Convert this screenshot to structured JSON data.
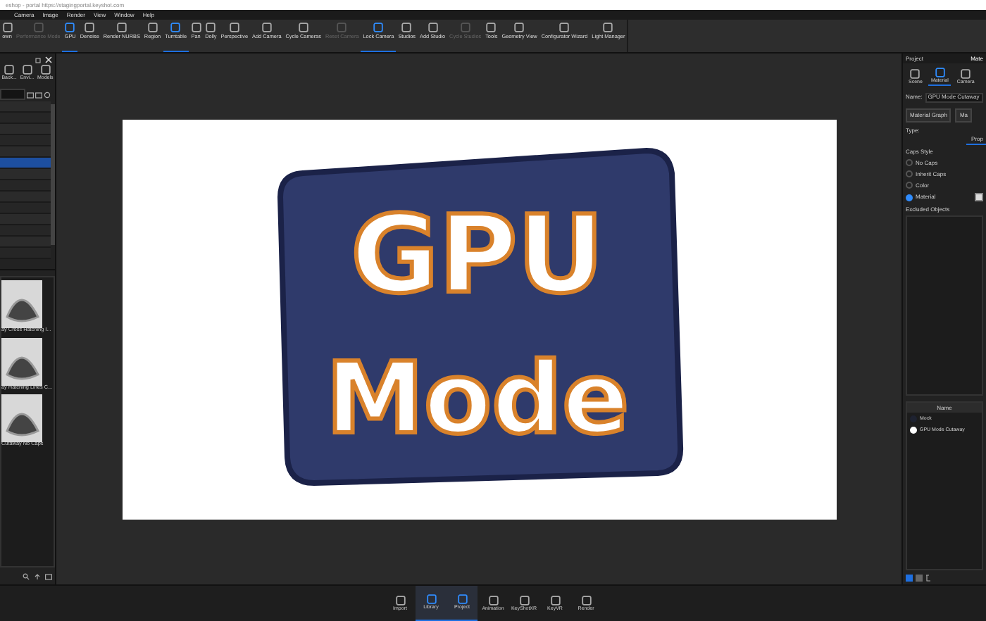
{
  "browser_bar": {
    "title": "eshop - portal https://stagingportal.keyshot.com"
  },
  "menu": [
    "Camera",
    "Image",
    "Render",
    "View",
    "Window",
    "Help"
  ],
  "toolbar": [
    {
      "label": "own",
      "selected": false,
      "disabled": false
    },
    {
      "label": "Performance Mode",
      "selected": false,
      "disabled": true
    },
    {
      "label": "GPU",
      "selected": true,
      "disabled": false
    },
    {
      "label": "Denoise",
      "selected": false,
      "disabled": false
    },
    {
      "label": "Render NURBS",
      "selected": false,
      "disabled": false
    },
    {
      "label": "Region",
      "selected": false,
      "disabled": false
    },
    {
      "label": "Turntable",
      "selected": true,
      "disabled": false
    },
    {
      "label": "Pan",
      "selected": false,
      "disabled": false
    },
    {
      "label": "Dolly",
      "selected": false,
      "disabled": false
    },
    {
      "label": "Perspective",
      "selected": false,
      "disabled": false
    },
    {
      "label": "Add Camera",
      "selected": false,
      "disabled": false
    },
    {
      "label": "Cycle Cameras",
      "selected": false,
      "disabled": false
    },
    {
      "label": "Reset Camera",
      "selected": false,
      "disabled": true
    },
    {
      "label": "Lock Camera",
      "selected": true,
      "disabled": false
    },
    {
      "label": "Studios",
      "selected": false,
      "disabled": false
    },
    {
      "label": "Add Studio",
      "selected": false,
      "disabled": false
    },
    {
      "label": "Cycle Studios",
      "selected": false,
      "disabled": true
    },
    {
      "label": "Tools",
      "selected": false,
      "disabled": false
    },
    {
      "label": "Geometry View",
      "selected": false,
      "disabled": false
    },
    {
      "label": "Configurator Wizard",
      "selected": false,
      "disabled": false
    },
    {
      "label": "Light Manager",
      "selected": false,
      "disabled": false
    }
  ],
  "left_panel": {
    "tabs": [
      {
        "label": "Back..."
      },
      {
        "label": "Envi..."
      },
      {
        "label": "Models"
      }
    ],
    "list_rows": [
      {
        "selected": false
      },
      {
        "selected": false
      },
      {
        "selected": false
      },
      {
        "selected": false
      },
      {
        "selected": false
      },
      {
        "selected": true
      },
      {
        "selected": false
      },
      {
        "selected": false
      },
      {
        "selected": false
      },
      {
        "selected": false
      },
      {
        "selected": false
      },
      {
        "selected": false
      },
      {
        "selected": false
      },
      {
        "selected": false
      }
    ],
    "thumbnails": [
      {
        "label": "ay Cross Hatching I..."
      },
      {
        "label": "ay Hatching Lines C..."
      },
      {
        "label": "Cutaway No Caps"
      }
    ]
  },
  "viewport": {
    "render_text": [
      "GPU",
      "Mode"
    ]
  },
  "right_panel": {
    "header": "Project",
    "header_2": "Mate",
    "tabs": [
      {
        "label": "Scene",
        "selected": false
      },
      {
        "label": "Material",
        "selected": true
      },
      {
        "label": "Camera",
        "selected": false
      }
    ],
    "name_label": "Name:",
    "name_value": "GPU Mode Cutaway",
    "buttons": [
      "Material Graph",
      "Ma"
    ],
    "type_label": "Type:",
    "sub_tab": "Prop",
    "caps_label": "Caps Style",
    "caps": [
      {
        "label": "No Caps",
        "selected": false
      },
      {
        "label": "Inherit Caps",
        "selected": false
      },
      {
        "label": "Color",
        "selected": false
      },
      {
        "label": "Material",
        "selected": true
      }
    ],
    "excluded_label": "Excluded Objects",
    "objects_header": "Name",
    "objects": [
      {
        "label": "Mock",
        "color": "#1e2230"
      },
      {
        "label": "GPU Mode Cutaway",
        "color": "#ffffff"
      }
    ]
  },
  "bottom_bar": [
    {
      "label": "Import",
      "selected": false
    },
    {
      "label": "Library",
      "selected": true
    },
    {
      "label": "Project",
      "selected": true
    },
    {
      "label": "Animation",
      "selected": false
    },
    {
      "label": "KeyShotXR",
      "selected": false
    },
    {
      "label": "KeyVR",
      "selected": false
    },
    {
      "label": "Render",
      "selected": false
    }
  ]
}
